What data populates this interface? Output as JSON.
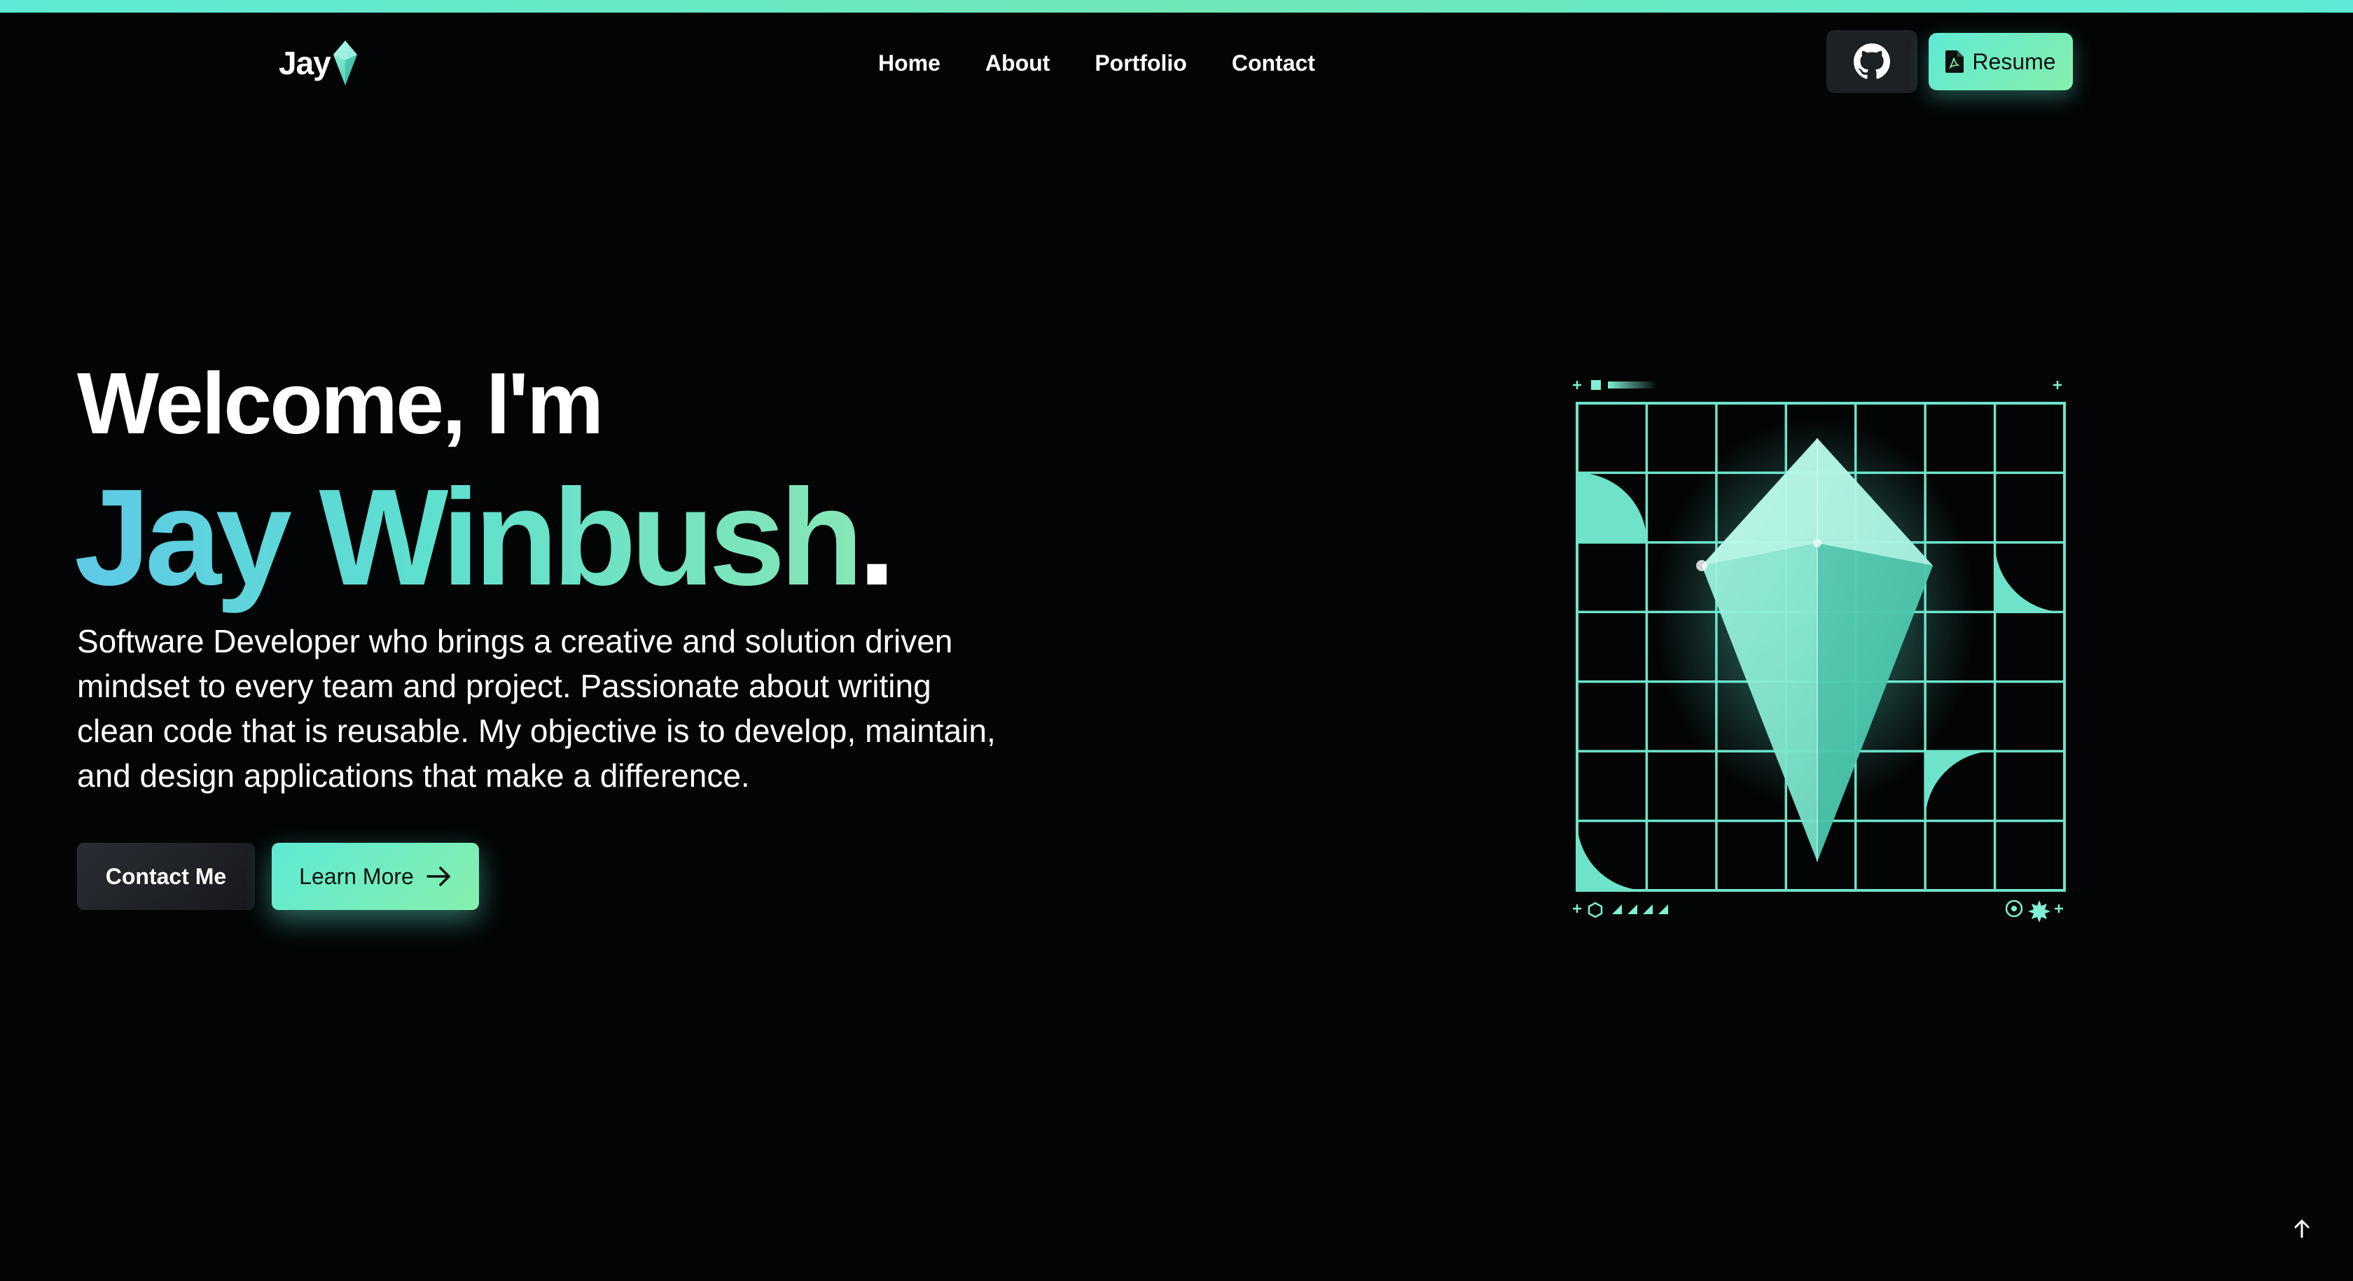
{
  "header": {
    "logo_text": "Jay",
    "nav": [
      {
        "label": "Home"
      },
      {
        "label": "About"
      },
      {
        "label": "Portfolio"
      },
      {
        "label": "Contact"
      }
    ],
    "resume_label": "Resume"
  },
  "hero": {
    "greeting": "Welcome, I'm",
    "name": "Jay Winbush",
    "name_suffix": ".",
    "description": "Software Developer who brings a creative and solution driven mindset to every team and project. Passionate about writing clean code that is reusable. My objective is to develop, maintain, and design applications that make a difference.",
    "contact_button": "Contact Me",
    "learn_button": "Learn More"
  },
  "colors": {
    "background": "#030405",
    "accent": "#5eead4",
    "accent_alt": "#86efac",
    "name_gradient_start": "#5ec9e6"
  },
  "icons": {
    "logo_mark": "crystal-icon",
    "github": "github-icon",
    "resume": "pdf-file-icon",
    "learn_more": "arrow-right-icon",
    "back_to_top": "arrow-up-icon"
  }
}
